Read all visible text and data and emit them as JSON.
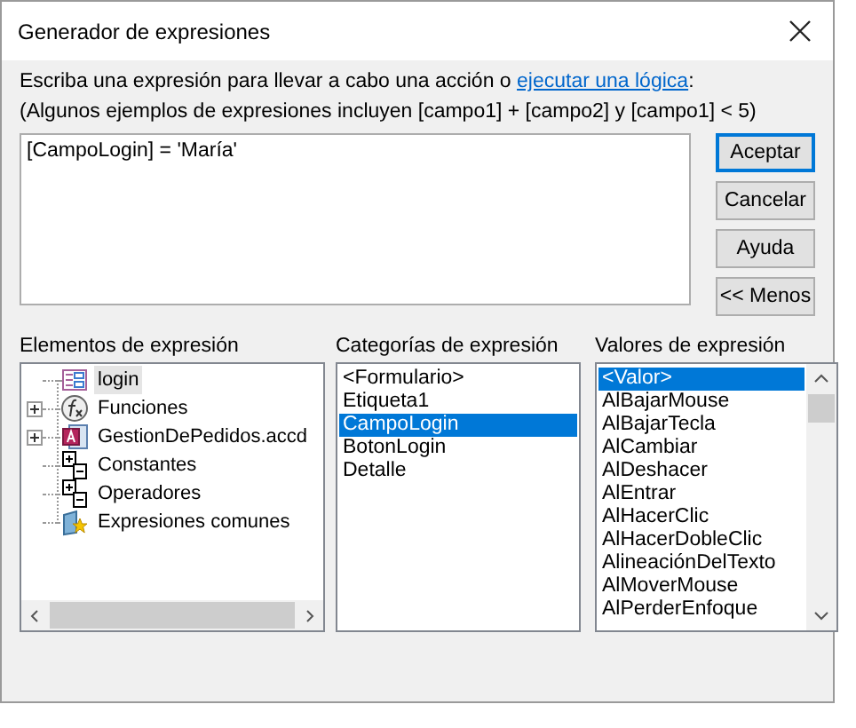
{
  "window": {
    "title": "Generador de expresiones"
  },
  "instructions": {
    "text": "Escriba una expresión para llevar a cabo una acción o ",
    "link": "ejecutar una lógica",
    "suffix": ":",
    "examples": "(Algunos ejemplos de expresiones incluyen [campo1] + [campo2] y [campo1] < 5)"
  },
  "expression": {
    "value": "[CampoLogin] = 'María'"
  },
  "buttons": [
    {
      "label": "Aceptar",
      "default": true
    },
    {
      "label": "Cancelar",
      "default": false
    },
    {
      "label": "Ayuda",
      "default": false
    },
    {
      "label": "<< Menos",
      "default": false
    }
  ],
  "elements": {
    "label": "Elementos de expresión",
    "items": [
      {
        "label": "login",
        "kind": "form",
        "expandable": false,
        "selected": true
      },
      {
        "label": "Funciones",
        "kind": "functions",
        "expandable": true,
        "selected": false
      },
      {
        "label": "GestionDePedidos.accd",
        "kind": "database",
        "expandable": true,
        "selected": false
      },
      {
        "label": "Constantes",
        "kind": "constants",
        "expandable": false,
        "selected": false
      },
      {
        "label": "Operadores",
        "kind": "operators",
        "expandable": false,
        "selected": false
      },
      {
        "label": "Expresiones comunes",
        "kind": "common",
        "expandable": false,
        "selected": false
      }
    ]
  },
  "categories": {
    "label": "Categorías de expresión",
    "items": [
      {
        "label": "<Formulario>",
        "selected": false
      },
      {
        "label": "Etiqueta1",
        "selected": false
      },
      {
        "label": "CampoLogin",
        "selected": true
      },
      {
        "label": "BotonLogin",
        "selected": false
      },
      {
        "label": "Detalle",
        "selected": false
      }
    ]
  },
  "values": {
    "label": "Valores de expresión",
    "items": [
      {
        "label": "<Valor>",
        "selected": true
      },
      {
        "label": "AlBajarMouse",
        "selected": false
      },
      {
        "label": "AlBajarTecla",
        "selected": false
      },
      {
        "label": "AlCambiar",
        "selected": false
      },
      {
        "label": "AlDeshacer",
        "selected": false
      },
      {
        "label": "AlEntrar",
        "selected": false
      },
      {
        "label": "AlHacerClic",
        "selected": false
      },
      {
        "label": "AlHacerDobleClic",
        "selected": false
      },
      {
        "label": "AlineaciónDelTexto",
        "selected": false
      },
      {
        "label": "AlMoverMouse",
        "selected": false
      },
      {
        "label": "AlPerderEnfoque",
        "selected": false
      }
    ]
  }
}
